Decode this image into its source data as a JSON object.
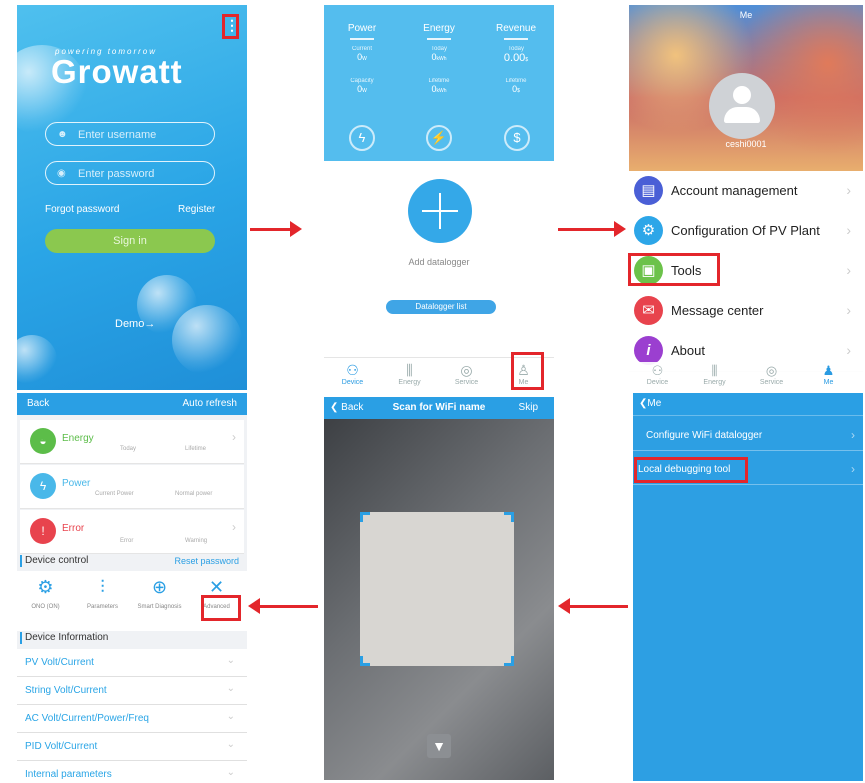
{
  "login": {
    "logo_text": "Growatt",
    "tagline": "powering tomorrow",
    "username_placeholder": "Enter username",
    "password_placeholder": "Enter password",
    "forgot_password": "Forgot password",
    "register": "Register",
    "sign_in": "Sign in",
    "demo": "Demo→",
    "menu_icon": "vertical-dots-icon"
  },
  "device": {
    "columns": [
      {
        "title": "Power",
        "top_label": "Current",
        "top_value": "0",
        "top_unit": "W",
        "bottom_label": "Capacity",
        "bottom_value": "0",
        "bottom_unit": "W"
      },
      {
        "title": "Energy",
        "top_label": "Today",
        "top_value": "0",
        "top_unit": "kWh",
        "bottom_label": "Lifetime",
        "bottom_value": "0",
        "bottom_unit": "kWh"
      },
      {
        "title": "Revenue",
        "top_label": "Today",
        "top_value": "0.00",
        "top_unit": "$",
        "bottom_label": "Lifetime",
        "bottom_value": "0",
        "bottom_unit": "$"
      }
    ],
    "add_datalogger": "Add datalogger",
    "datalogger_list": "Datalogger list",
    "tabs": [
      "Device",
      "Energy",
      "Service",
      "Me"
    ]
  },
  "me": {
    "title": "Me",
    "username": "ceshi0001",
    "menu": [
      {
        "label": "Account management",
        "icon": "id-card-icon",
        "color": "#4a5fd6"
      },
      {
        "label": "Configuration Of PV Plant",
        "icon": "gear-icon",
        "color": "#2da6e8"
      },
      {
        "label": "Tools",
        "icon": "toolbox-icon",
        "color": "#6cc24a"
      },
      {
        "label": "Message center",
        "icon": "message-icon",
        "color": "#e8434d"
      },
      {
        "label": "About",
        "icon": "info-icon",
        "color": "#9b3fd0"
      }
    ],
    "tabs": [
      "Device",
      "Energy",
      "Service",
      "Me"
    ]
  },
  "detail": {
    "back": "Back",
    "auto_refresh": "Auto refresh",
    "cards": [
      {
        "title": "Energy",
        "sub1": "Today",
        "sub2": "Lifetime",
        "color": "#5cbd49"
      },
      {
        "title": "Power",
        "sub1": "Current Power",
        "sub2": "Normal power",
        "color": "#49b8e9"
      },
      {
        "title": "Error",
        "sub1": "Error",
        "sub2": "Warning",
        "color": "#e8434d"
      }
    ],
    "device_control": "Device control",
    "reset_password": "Reset password",
    "controls": [
      "ONO (ON)",
      "Parameters",
      "Smart Diagnosis",
      "Advanced"
    ],
    "device_information": "Device Information",
    "info_items": [
      "PV Volt/Current",
      "String Volt/Current",
      "AC Volt/Current/Power/Freq",
      "PID Volt/Current",
      "Internal parameters"
    ]
  },
  "scan": {
    "back": "Back",
    "title": "Scan for WiFi name",
    "skip": "Skip",
    "flashlight_icon": "flashlight-icon"
  },
  "wifi": {
    "back": "Me",
    "items": [
      "Configure WiFi datalogger",
      "Local debugging tool"
    ]
  }
}
